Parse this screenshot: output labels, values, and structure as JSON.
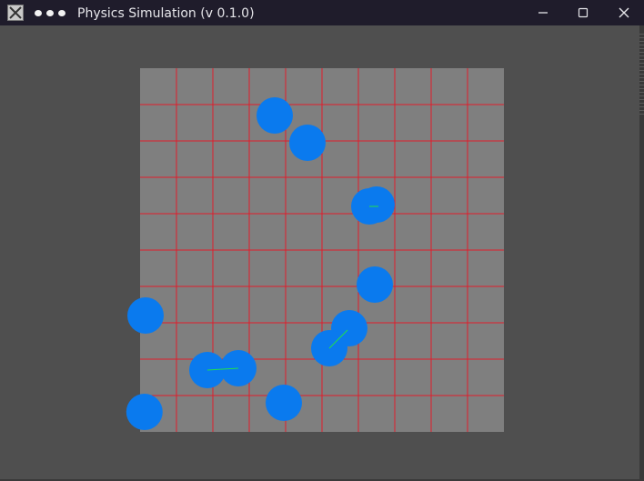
{
  "window": {
    "title": "Physics Simulation (v 0.1.0)",
    "app_icon": "x-app-icon",
    "menu_icon": "three-dots-menu-icon",
    "controls": {
      "minimize": "minimize-icon",
      "maximize": "maximize-icon",
      "close": "close-icon"
    }
  },
  "simulation": {
    "grid": {
      "rows": 10,
      "cols": 10
    },
    "colors": {
      "background": "#4f4f4f",
      "board": "#7f7f7f",
      "grid_lines": "#e01c2b",
      "ball": "#0a7aee",
      "velocity_vector": "#22e04a"
    },
    "balls": [
      {
        "id": 1,
        "cx": 3.7,
        "cy": 1.3,
        "r": 0.5
      },
      {
        "id": 2,
        "cx": 4.6,
        "cy": 2.05,
        "r": 0.5
      },
      {
        "id": 3,
        "cx": 6.3,
        "cy": 3.8,
        "r": 0.5,
        "vx": 0.25,
        "vy": 0.0
      },
      {
        "id": 4,
        "cx": 6.5,
        "cy": 3.75,
        "r": 0.5
      },
      {
        "id": 5,
        "cx": 6.45,
        "cy": 5.95,
        "r": 0.5
      },
      {
        "id": 6,
        "cx": 0.15,
        "cy": 6.8,
        "r": 0.5
      },
      {
        "id": 7,
        "cx": 5.75,
        "cy": 7.15,
        "r": 0.5
      },
      {
        "id": 8,
        "cx": 5.2,
        "cy": 7.7,
        "r": 0.5,
        "vx": 0.5,
        "vy": -0.5
      },
      {
        "id": 9,
        "cx": 1.85,
        "cy": 8.3,
        "r": 0.5,
        "vx": 0.85,
        "vy": -0.05
      },
      {
        "id": 10,
        "cx": 2.7,
        "cy": 8.25,
        "r": 0.5
      },
      {
        "id": 11,
        "cx": 3.95,
        "cy": 9.2,
        "r": 0.5
      },
      {
        "id": 12,
        "cx": 0.12,
        "cy": 9.45,
        "r": 0.5
      }
    ]
  }
}
